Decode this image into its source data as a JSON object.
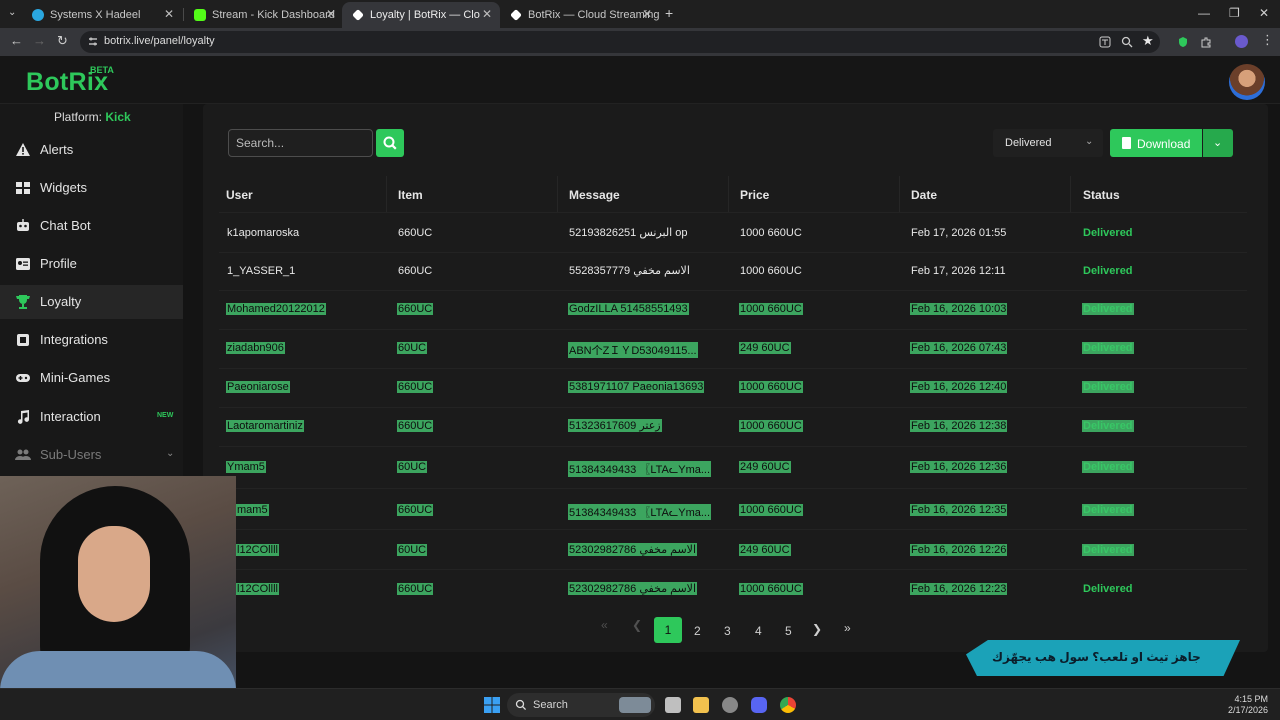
{
  "browser": {
    "tabs": [
      {
        "title": "Systems X Hadeel",
        "color": "#2aa7e0"
      },
      {
        "title": "Stream - Kick Dashboard",
        "color": "#53fc18"
      },
      {
        "title": "Loyalty | BotRix — Cloud Strea",
        "color": "#ffffff"
      },
      {
        "title": "BotRix — Cloud Streaming Bot",
        "color": "#ffffff"
      }
    ],
    "url": "botrix.live/panel/loyalty"
  },
  "app": {
    "logo": "BotRix",
    "beta": "BETA",
    "platform_label": "Platform:",
    "platform_value": "Kick",
    "accent": "#2ec85b"
  },
  "sidebar": {
    "items": [
      {
        "label": "Alerts",
        "icon": "alert-icon"
      },
      {
        "label": "Widgets",
        "icon": "widgets-icon"
      },
      {
        "label": "Chat Bot",
        "icon": "robot-icon"
      },
      {
        "label": "Profile",
        "icon": "profile-icon"
      },
      {
        "label": "Loyalty",
        "icon": "trophy-icon"
      },
      {
        "label": "Integrations",
        "icon": "integrations-icon"
      },
      {
        "label": "Mini-Games",
        "icon": "gamepad-icon"
      },
      {
        "label": "Interaction",
        "icon": "music-icon",
        "badge": "NEW"
      },
      {
        "label": "Sub-Users",
        "icon": "users-icon"
      }
    ],
    "active": "Loyalty"
  },
  "toolbar": {
    "search_placeholder": "Search...",
    "status_filter": "Delivered",
    "download_label": "Download"
  },
  "table": {
    "headers": [
      "User",
      "Item",
      "Message",
      "Price",
      "Date",
      "Status"
    ],
    "rows": [
      {
        "user": "k1apomaroska",
        "item": "660UC",
        "message": "52193826251 البرنس op",
        "price": "1000 660UC",
        "date": "Feb 17, 2026 01:55",
        "status": "Delivered"
      },
      {
        "user": "1_YASSER_1",
        "item": "660UC",
        "message": "5528357779 الاسم مخفي",
        "price": "1000 660UC",
        "date": "Feb 17, 2026 12:11",
        "status": "Delivered"
      },
      {
        "user": "Mohamed20122012",
        "item": "660UC",
        "message": "GodzILLA 51458551493",
        "price": "1000 660UC",
        "date": "Feb 16, 2026 10:03",
        "status": "Delivered"
      },
      {
        "user": "ziadabn906",
        "item": "60UC",
        "message": "ABN个ZＩＹD53049115...",
        "price": "249 60UC",
        "date": "Feb 16, 2026 07:43",
        "status": "Delivered"
      },
      {
        "user": "Paeoniarose",
        "item": "660UC",
        "message": "5381971107 Paeonia13693",
        "price": "1000 660UC",
        "date": "Feb 16, 2026 12:40",
        "status": "Delivered"
      },
      {
        "user": "Laotaromartiniz",
        "item": "660UC",
        "message": "51323617609 زعتر",
        "price": "1000 660UC",
        "date": "Feb 16, 2026 12:38",
        "status": "Delivered"
      },
      {
        "user": "Ymam5",
        "item": "60UC",
        "message": "51384349433 〖LTAᓚYma...",
        "price": "249 60UC",
        "date": "Feb 16, 2026 12:36",
        "status": "Delivered"
      },
      {
        "user": "mam5",
        "item": "660UC",
        "message": "51384349433 〖LTAᓚYma...",
        "price": "1000 660UC",
        "date": "Feb 16, 2026 12:35",
        "status": "Delivered"
      },
      {
        "user": "l12COllll",
        "item": "60UC",
        "message": "52302982786 الاسم مخفي",
        "price": "249 60UC",
        "date": "Feb 16, 2026 12:26",
        "status": "Delivered"
      },
      {
        "user": "l12COllll",
        "item": "660UC",
        "message": "52302982786 الاسم مخفي",
        "price": "1000 660UC",
        "date": "Feb 16, 2026 12:23",
        "status": "Delivered"
      }
    ]
  },
  "pagination": {
    "pages": [
      "1",
      "2",
      "3",
      "4",
      "5"
    ],
    "current": "1"
  },
  "overlay": {
    "promo_text": "جاهز تيث او تلعب؟ سول هب يجهّزك"
  },
  "taskbar": {
    "search_label": "Search",
    "time": "4:15 PM",
    "date": "2/17/2026"
  }
}
